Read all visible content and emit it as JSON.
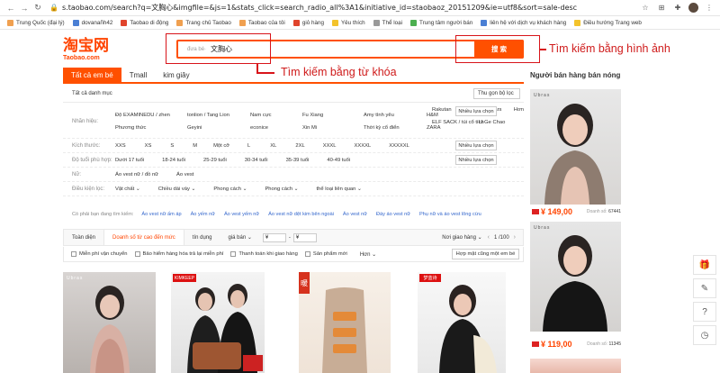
{
  "browser": {
    "url": "s.taobao.com/search?q=文胸心&imgfile=&js=1&stats_click=search_radio_all%3A1&initiative_id=staobaoz_20151209&ie=utf8&sort=sale-desc",
    "bookmarks": [
      "Trung Quốc (đại lý)",
      "dovanañh42",
      "Taobao di động",
      "Trang chủ Taobao",
      "Taobao của tôi",
      "giỏ hàng",
      "Yêu thích",
      "Thể loại",
      "Trung tâm người bán",
      "liên hệ với dịch vụ khách hàng",
      "Điều hướng Trang web"
    ]
  },
  "logo": {
    "main": "淘宝网",
    "sub": "Taobao.com"
  },
  "search": {
    "hint": "đưa bé·",
    "query": "文胸心",
    "button": "搜 索"
  },
  "annotations": {
    "keyword": "Tìm kiếm bằng từ khóa",
    "image": "Tìm kiếm bằng hình ảnh"
  },
  "tabs": [
    "Tất cả em bé",
    "Tmall",
    "kim giây"
  ],
  "right_column": {
    "title": "Người bán hàng bán nóng"
  },
  "filters": {
    "category_label": "Tất cả danh mục",
    "category_right": "Thu gọn bộ lọc",
    "rows": [
      {
        "label": "Nhãn hiệu:",
        "values": [
          "Độ EXAMINEDU / zhen",
          "tonlion / Tang Lion",
          "Nam cực",
          "Fu Xiang",
          "Amy tình yêu",
          "H&M",
          "Rakutan",
          "Momstars",
          "Phương thức",
          "Geyini",
          "econice",
          "Xin Mi",
          "Thời kỳ cổ điển",
          "ZARA",
          "ELF SACK / túi cổ tích",
          "Li Ge Chao"
        ],
        "more": "Nhiều lựa chọn",
        "extra": "Hơn"
      },
      {
        "label": "Kích thước:",
        "values": [
          "XXS",
          "XS",
          "S",
          "M",
          "Một cỡ",
          "L",
          "XL",
          "2XL",
          "XXXL",
          "XXXXL",
          "XXXXXL"
        ],
        "more": "Nhiều lựa chọn"
      },
      {
        "label": "Độ tuổi phù hợp:",
        "values": [
          "Dưới 17 tuổi",
          "18-24 tuổi",
          "25-29 tuổi",
          "30-34 tuổi",
          "35-39 tuổi",
          "40-49 tuổi"
        ],
        "more": "Nhiều lựa chọn"
      },
      {
        "label": "Nữ:",
        "values": [
          "Áo vest nữ / đồ nữ",
          "Áo vest"
        ]
      },
      {
        "label": "Điều kiện lọc:",
        "values": [
          "Vật chất ⌄",
          "Chiều dài váy ⌄",
          "Phong cách ⌄",
          "Phong cách ⌄",
          "thể loại liên quan ⌄"
        ]
      }
    ]
  },
  "suggest": {
    "label": "Có phải bạn đang tìm kiếm:",
    "items": [
      "Áo vest nữ ấm áp",
      "Áo yếm nữ",
      "Áo vest yếm nữ",
      "Áo vest nữ dệt kim bên ngoài",
      "Áo vest nữ",
      "Đáy áo vest nữ",
      "Phụ nữ và áo vest lông cừu"
    ]
  },
  "sort": {
    "items": [
      "Toàn diện",
      "Doanh số từ cao đến mức",
      "tín dụng",
      "giá bán ⌄"
    ],
    "price_from": "¥",
    "price_to": "¥",
    "ship": "Nơi giao hàng ⌄",
    "page": "1 /100"
  },
  "options": [
    "Miễn phí vận chuyển",
    "Bảo hiểm hàng hóa trả lại miễn phí",
    "Thanh toán khi giao hàng",
    "Sản phẩm mới"
  ],
  "options_more": "Hơn ⌄",
  "options_right": "Hợp mặt cũng một em bé",
  "products": {
    "p1_brand": "Ubras",
    "p2_tag": "KIMKEEP",
    "p3_tag": "暖",
    "p4_tag": "梦蓝诗"
  },
  "side_products": [
    {
      "brand": "Ubras",
      "price": "149,00",
      "sales_label": "Doanh số:",
      "sales": "67441"
    },
    {
      "brand": "Ubras",
      "price": "119,00",
      "sales_label": "Doanh số:",
      "sales": "11345"
    }
  ],
  "colors": {
    "accent": "#ff5000",
    "annotation": "#d8141a",
    "link": "#3366cc"
  }
}
